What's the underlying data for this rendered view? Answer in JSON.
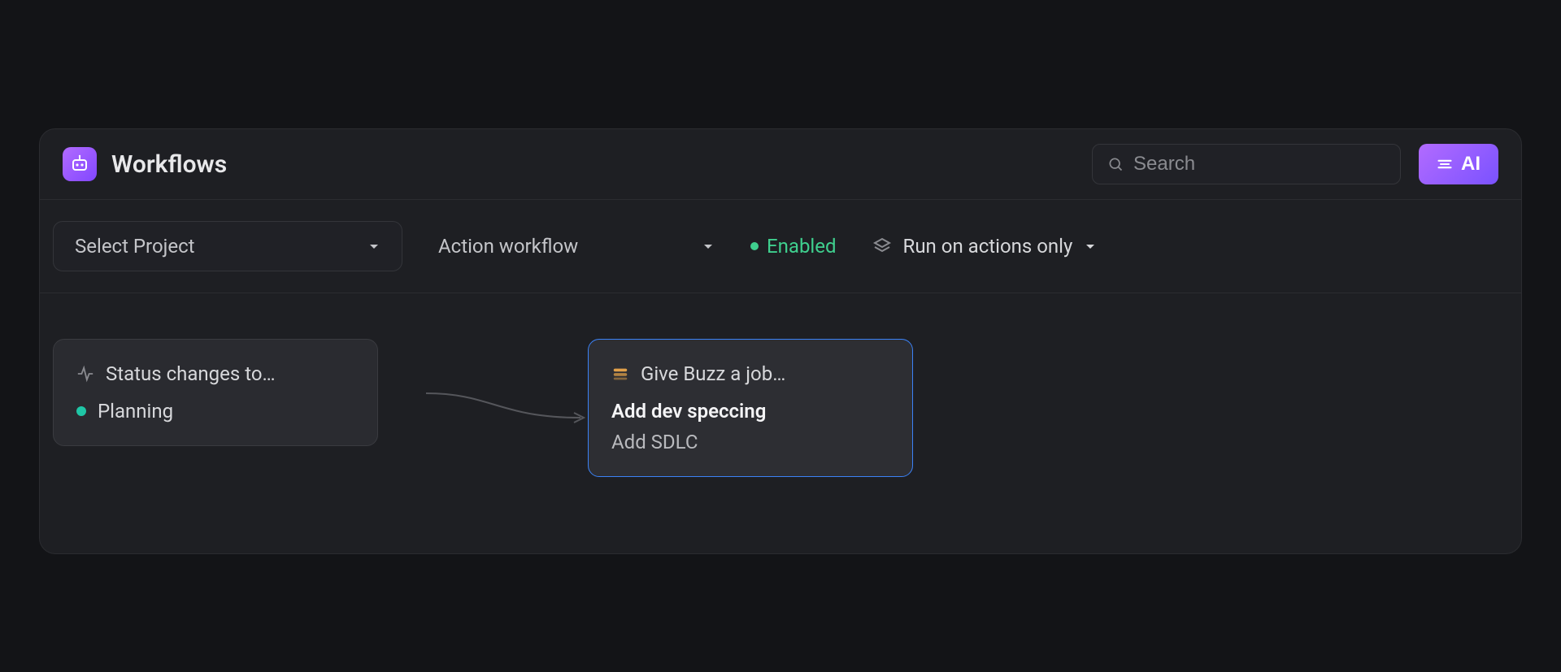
{
  "header": {
    "title": "Workflows",
    "search_placeholder": "Search",
    "ai_label": "AI"
  },
  "toolbar": {
    "project_select_label": "Select Project",
    "workflow_select_label": "Action workflow",
    "status_label": "Enabled",
    "run_mode_label": "Run on actions only"
  },
  "nodes": {
    "trigger": {
      "title": "Status changes to…",
      "status_label": "Planning",
      "status_color": "#1fc6a6"
    },
    "action": {
      "title": "Give Buzz a job…",
      "line1": "Add dev speccing",
      "line2": "Add SDLC"
    }
  },
  "colors": {
    "accent_purple": "#9a5bff",
    "enabled_green": "#3fcf8e",
    "selection_blue": "#3b82f6"
  }
}
